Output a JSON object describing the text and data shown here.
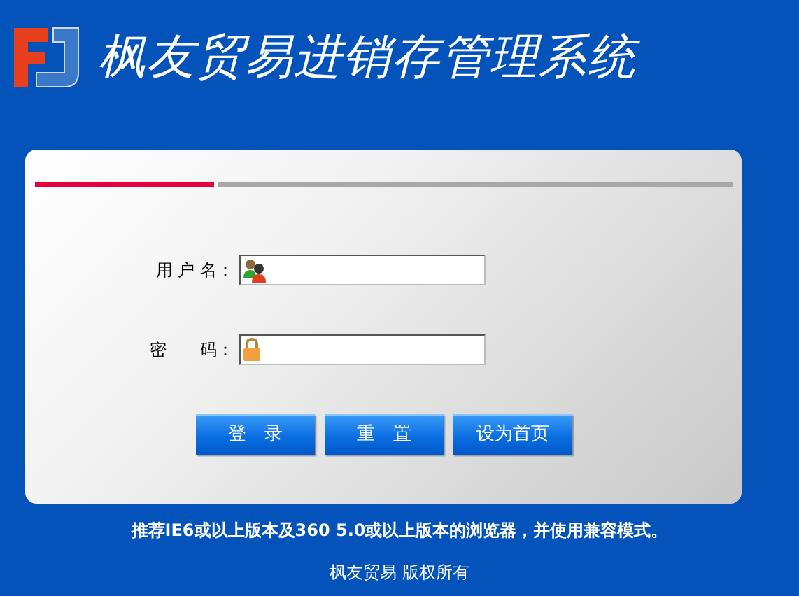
{
  "header": {
    "title": "枫友贸易进销存管理系统"
  },
  "login": {
    "fields": [
      {
        "label": "用 户 名：",
        "kind": "user"
      },
      {
        "label": "密　　码：",
        "kind": "password"
      }
    ],
    "buttons": [
      "登　录",
      "重　置",
      "设为首页"
    ]
  },
  "footer": {
    "notice": "推荐IE6或以上版本及360 5.0或以上版本的浏览器，并使用兼容模式。",
    "copyright": "枫友贸易 版权所有"
  }
}
